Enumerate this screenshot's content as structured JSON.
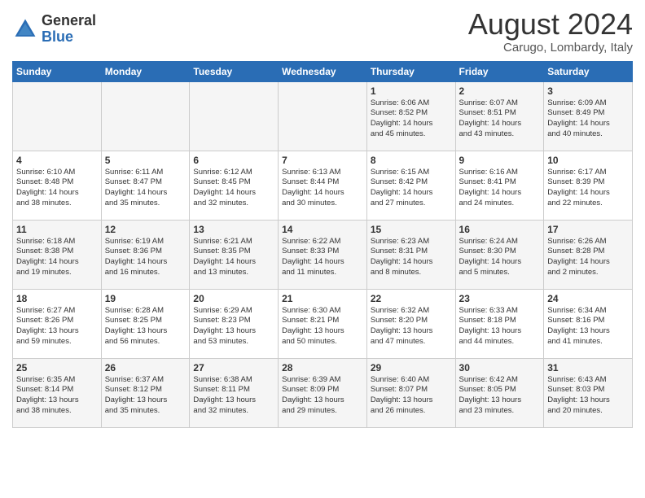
{
  "header": {
    "logo_general": "General",
    "logo_blue": "Blue",
    "title": "August 2024",
    "subtitle": "Carugo, Lombardy, Italy"
  },
  "weekdays": [
    "Sunday",
    "Monday",
    "Tuesday",
    "Wednesday",
    "Thursday",
    "Friday",
    "Saturday"
  ],
  "weeks": [
    [
      {
        "day": "",
        "info": ""
      },
      {
        "day": "",
        "info": ""
      },
      {
        "day": "",
        "info": ""
      },
      {
        "day": "",
        "info": ""
      },
      {
        "day": "1",
        "info": "Sunrise: 6:06 AM\nSunset: 8:52 PM\nDaylight: 14 hours\nand 45 minutes."
      },
      {
        "day": "2",
        "info": "Sunrise: 6:07 AM\nSunset: 8:51 PM\nDaylight: 14 hours\nand 43 minutes."
      },
      {
        "day": "3",
        "info": "Sunrise: 6:09 AM\nSunset: 8:49 PM\nDaylight: 14 hours\nand 40 minutes."
      }
    ],
    [
      {
        "day": "4",
        "info": "Sunrise: 6:10 AM\nSunset: 8:48 PM\nDaylight: 14 hours\nand 38 minutes."
      },
      {
        "day": "5",
        "info": "Sunrise: 6:11 AM\nSunset: 8:47 PM\nDaylight: 14 hours\nand 35 minutes."
      },
      {
        "day": "6",
        "info": "Sunrise: 6:12 AM\nSunset: 8:45 PM\nDaylight: 14 hours\nand 32 minutes."
      },
      {
        "day": "7",
        "info": "Sunrise: 6:13 AM\nSunset: 8:44 PM\nDaylight: 14 hours\nand 30 minutes."
      },
      {
        "day": "8",
        "info": "Sunrise: 6:15 AM\nSunset: 8:42 PM\nDaylight: 14 hours\nand 27 minutes."
      },
      {
        "day": "9",
        "info": "Sunrise: 6:16 AM\nSunset: 8:41 PM\nDaylight: 14 hours\nand 24 minutes."
      },
      {
        "day": "10",
        "info": "Sunrise: 6:17 AM\nSunset: 8:39 PM\nDaylight: 14 hours\nand 22 minutes."
      }
    ],
    [
      {
        "day": "11",
        "info": "Sunrise: 6:18 AM\nSunset: 8:38 PM\nDaylight: 14 hours\nand 19 minutes."
      },
      {
        "day": "12",
        "info": "Sunrise: 6:19 AM\nSunset: 8:36 PM\nDaylight: 14 hours\nand 16 minutes."
      },
      {
        "day": "13",
        "info": "Sunrise: 6:21 AM\nSunset: 8:35 PM\nDaylight: 14 hours\nand 13 minutes."
      },
      {
        "day": "14",
        "info": "Sunrise: 6:22 AM\nSunset: 8:33 PM\nDaylight: 14 hours\nand 11 minutes."
      },
      {
        "day": "15",
        "info": "Sunrise: 6:23 AM\nSunset: 8:31 PM\nDaylight: 14 hours\nand 8 minutes."
      },
      {
        "day": "16",
        "info": "Sunrise: 6:24 AM\nSunset: 8:30 PM\nDaylight: 14 hours\nand 5 minutes."
      },
      {
        "day": "17",
        "info": "Sunrise: 6:26 AM\nSunset: 8:28 PM\nDaylight: 14 hours\nand 2 minutes."
      }
    ],
    [
      {
        "day": "18",
        "info": "Sunrise: 6:27 AM\nSunset: 8:26 PM\nDaylight: 13 hours\nand 59 minutes."
      },
      {
        "day": "19",
        "info": "Sunrise: 6:28 AM\nSunset: 8:25 PM\nDaylight: 13 hours\nand 56 minutes."
      },
      {
        "day": "20",
        "info": "Sunrise: 6:29 AM\nSunset: 8:23 PM\nDaylight: 13 hours\nand 53 minutes."
      },
      {
        "day": "21",
        "info": "Sunrise: 6:30 AM\nSunset: 8:21 PM\nDaylight: 13 hours\nand 50 minutes."
      },
      {
        "day": "22",
        "info": "Sunrise: 6:32 AM\nSunset: 8:20 PM\nDaylight: 13 hours\nand 47 minutes."
      },
      {
        "day": "23",
        "info": "Sunrise: 6:33 AM\nSunset: 8:18 PM\nDaylight: 13 hours\nand 44 minutes."
      },
      {
        "day": "24",
        "info": "Sunrise: 6:34 AM\nSunset: 8:16 PM\nDaylight: 13 hours\nand 41 minutes."
      }
    ],
    [
      {
        "day": "25",
        "info": "Sunrise: 6:35 AM\nSunset: 8:14 PM\nDaylight: 13 hours\nand 38 minutes."
      },
      {
        "day": "26",
        "info": "Sunrise: 6:37 AM\nSunset: 8:12 PM\nDaylight: 13 hours\nand 35 minutes."
      },
      {
        "day": "27",
        "info": "Sunrise: 6:38 AM\nSunset: 8:11 PM\nDaylight: 13 hours\nand 32 minutes."
      },
      {
        "day": "28",
        "info": "Sunrise: 6:39 AM\nSunset: 8:09 PM\nDaylight: 13 hours\nand 29 minutes."
      },
      {
        "day": "29",
        "info": "Sunrise: 6:40 AM\nSunset: 8:07 PM\nDaylight: 13 hours\nand 26 minutes."
      },
      {
        "day": "30",
        "info": "Sunrise: 6:42 AM\nSunset: 8:05 PM\nDaylight: 13 hours\nand 23 minutes."
      },
      {
        "day": "31",
        "info": "Sunrise: 6:43 AM\nSunset: 8:03 PM\nDaylight: 13 hours\nand 20 minutes."
      }
    ]
  ]
}
